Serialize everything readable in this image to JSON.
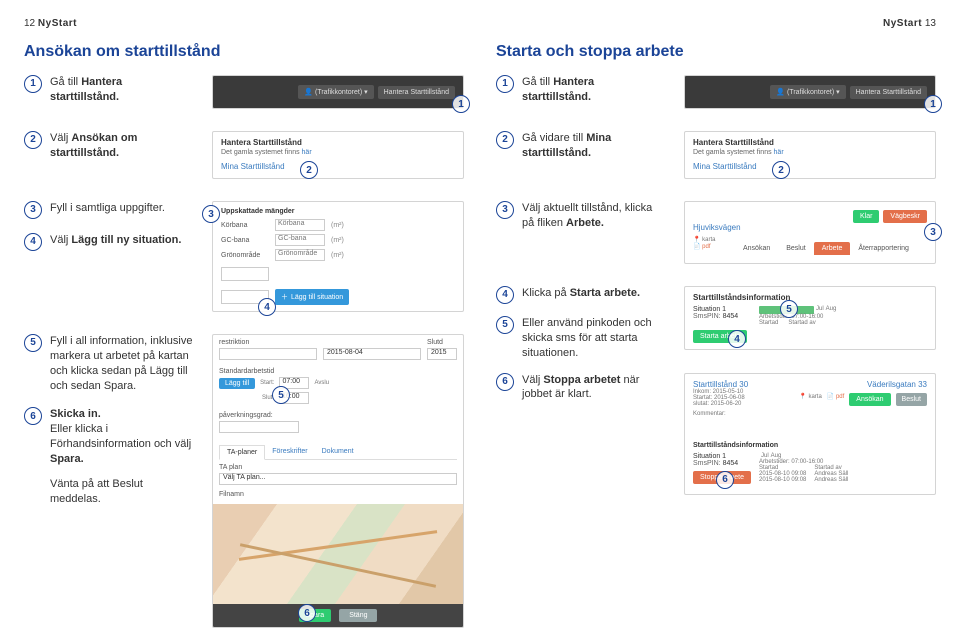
{
  "page_left_num": "12",
  "page_right_num": "13",
  "brand_prefix": "Ny",
  "brand_suffix": "Start",
  "left": {
    "title": "Ansökan om starttillstånd",
    "step1": "Gå till ",
    "step1b": "Hantera starttillstånd.",
    "step2a": "Välj ",
    "step2b": "Ansökan om starttillstånd.",
    "step3": "Fyll i samtliga uppgifter.",
    "step4a": "Välj ",
    "step4b": "Lägg till ny situation.",
    "step5": "Fyll i all information, inklusive markera ut arbetet på kartan och klicka sedan på Lägg till och sedan Spara.",
    "step6a": "Skicka in.",
    "step6b": "Eller klicka i Förhandsinformation och välj ",
    "step6c": "Spara.",
    "step6d": "Vänta på att Beslut meddelas."
  },
  "right": {
    "title": "Starta och stoppa arbete",
    "step1": "Gå till ",
    "step1b": "Hantera starttillstånd.",
    "step2": "Gå vidare till ",
    "step2b": "Mina starttillstånd.",
    "step3": "Välj aktuellt tillstånd, klicka på fliken ",
    "step3b": "Arbete.",
    "step4": "Klicka på ",
    "step4b": "Starta arbete.",
    "step5": "Eller använd pinkoden och skicka sms för att starta situationen.",
    "step6a": "Välj ",
    "step6b": "Stoppa arbetet",
    "step6c": " när jobbet är klart."
  },
  "topbar": {
    "chip1": "(Trafikkontoret) ▾",
    "chip2": "Hantera Starttillstånd"
  },
  "hantera": {
    "title": "Hantera Starttillstånd",
    "sub_a": "Det gamla systemet finns ",
    "sub_b": "här",
    "link": "Mina Starttillstånd"
  },
  "form": {
    "head": "Uppskattade mängder",
    "r1l": "Körbana",
    "r1p": "Körbana",
    "u": "(m²)",
    "r2l": "GC-bana",
    "r2p": "GC-bana",
    "r3l": "Grönområde",
    "r3p": "Grönområde",
    "btn": "Lägg till situation"
  },
  "tabbar": {
    "klar": "Klar",
    "vag": "Vägbeskr",
    "street": "Hjuviksvägen",
    "karta": "karta",
    "pdf": "pdf",
    "t1": "Ansökan",
    "t2": "Beslut",
    "t3": "Arbete",
    "t4": "Återrapportering"
  },
  "sitinfo": {
    "hdr": "Starttillståndsinformation",
    "sit": "Situation 1",
    "pin_l": "SmsPIN:",
    "pin_v": "8454",
    "tid_l": "Arbetstider:",
    "tid_v": "07:00-16:00",
    "startad": "Startad",
    "startad_av": "Startad av",
    "btn_start": "Starta arbete",
    "btn_stop": "Stoppa arbete",
    "aug": "Aug",
    "jul": "Jul"
  },
  "bigform": {
    "restr": "restriktion",
    "date": "2015-08-04",
    "slut": "Slutd",
    "date2": "2015",
    "std": "Standardarbetstid",
    "arb": "Arbe",
    "lagg": "Lägg till",
    "start": "Start:",
    "sv": "07:00",
    "av": "Avslu",
    "slutt": "Slut:",
    "sv2": "16:00",
    "pav": "påverkningsgrad:",
    "tap": "TA-planer",
    "for": "Föreskrifter",
    "dok": "Dokument",
    "taplan": "TA plan",
    "valj": "Välj TA plan...",
    "fil": "Filnamn",
    "spara": "Spara",
    "stang": "Stäng"
  },
  "detail": {
    "name": "Starttillstånd 30",
    "addr": "Väderilsgatan 33",
    "ink": "Inkom: 2015-05-10",
    "sta": "Startat: 2015-06-08",
    "sl": "slutat: 2015-06-20",
    "karta": "karta",
    "pdf": "pdf",
    "ans": "Ansökan",
    "bes": "Beslut",
    "kom": "Kommentar:",
    "line1": "2015-08-10 09:08",
    "name1": "Andreas Säll",
    "line2": "2015-08-10 09:08",
    "name2": "Andreas Säll"
  }
}
